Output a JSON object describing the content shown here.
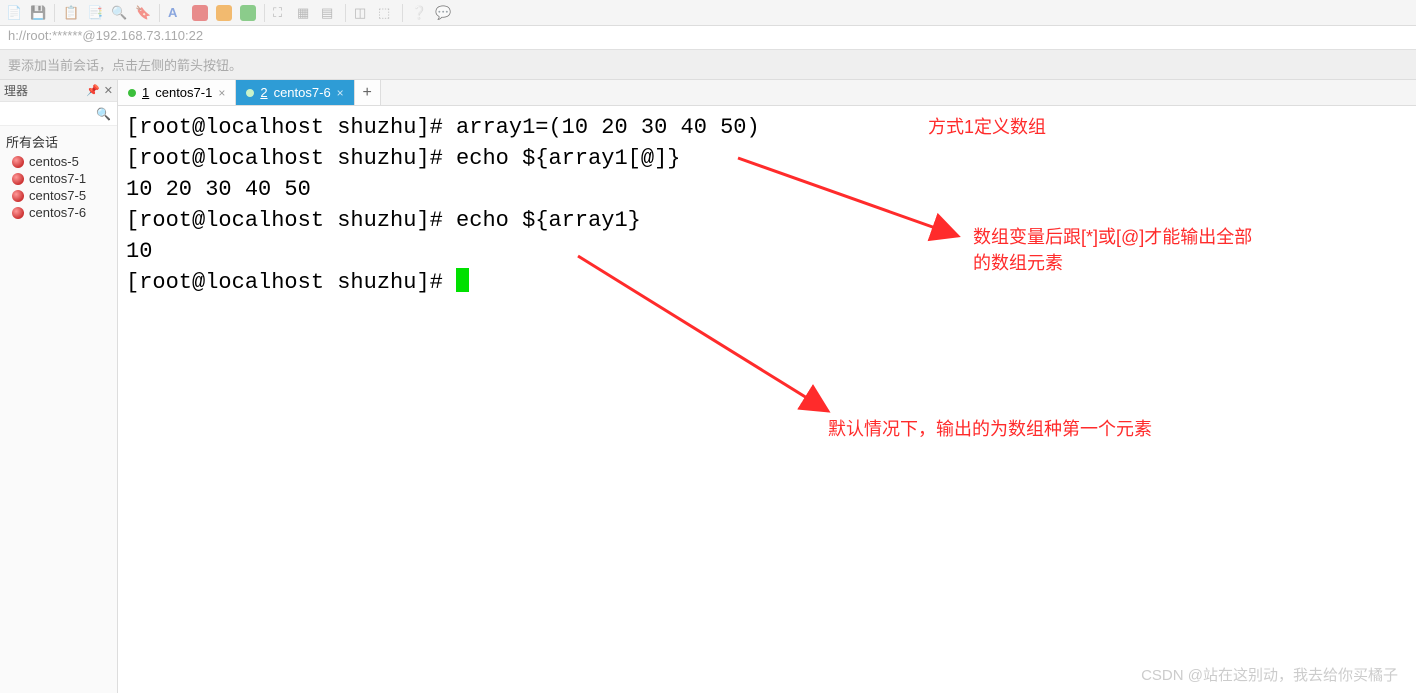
{
  "toolbar_icons": [
    "file",
    "save",
    "copy",
    "paste",
    "search",
    "bookmark",
    "font",
    "color1",
    "color2",
    "color3",
    "fullscreen",
    "grid",
    "table",
    "list",
    "layout",
    "help",
    "chat"
  ],
  "address": "h://root:******@192.168.73.110:22",
  "hint": "要添加当前会话，点击左侧的箭头按钮。",
  "sidebar": {
    "title": "理器",
    "root": "所有会话",
    "items": [
      "centos-5",
      "centos7-1",
      "centos7-5",
      "centos7-6"
    ]
  },
  "tabs": [
    {
      "num": "1",
      "label": "centos7-1",
      "active": false
    },
    {
      "num": "2",
      "label": "centos7-6",
      "active": true
    }
  ],
  "terminal": {
    "lines": [
      "[root@localhost shuzhu]# array1=(10 20 30 40 50)",
      "[root@localhost shuzhu]# echo ${array1[@]}",
      "10 20 30 40 50",
      "[root@localhost shuzhu]# echo ${array1}",
      "10",
      "[root@localhost shuzhu]# "
    ]
  },
  "annotations": {
    "a1": "方式1定义数组",
    "a2_line1": "数组变量后跟[*]或[@]才能输出全部",
    "a2_line2": "的数组元素",
    "a3": "默认情况下，输出的为数组种第一个元素"
  },
  "watermark": "CSDN @站在这别动，我去给你买橘子"
}
